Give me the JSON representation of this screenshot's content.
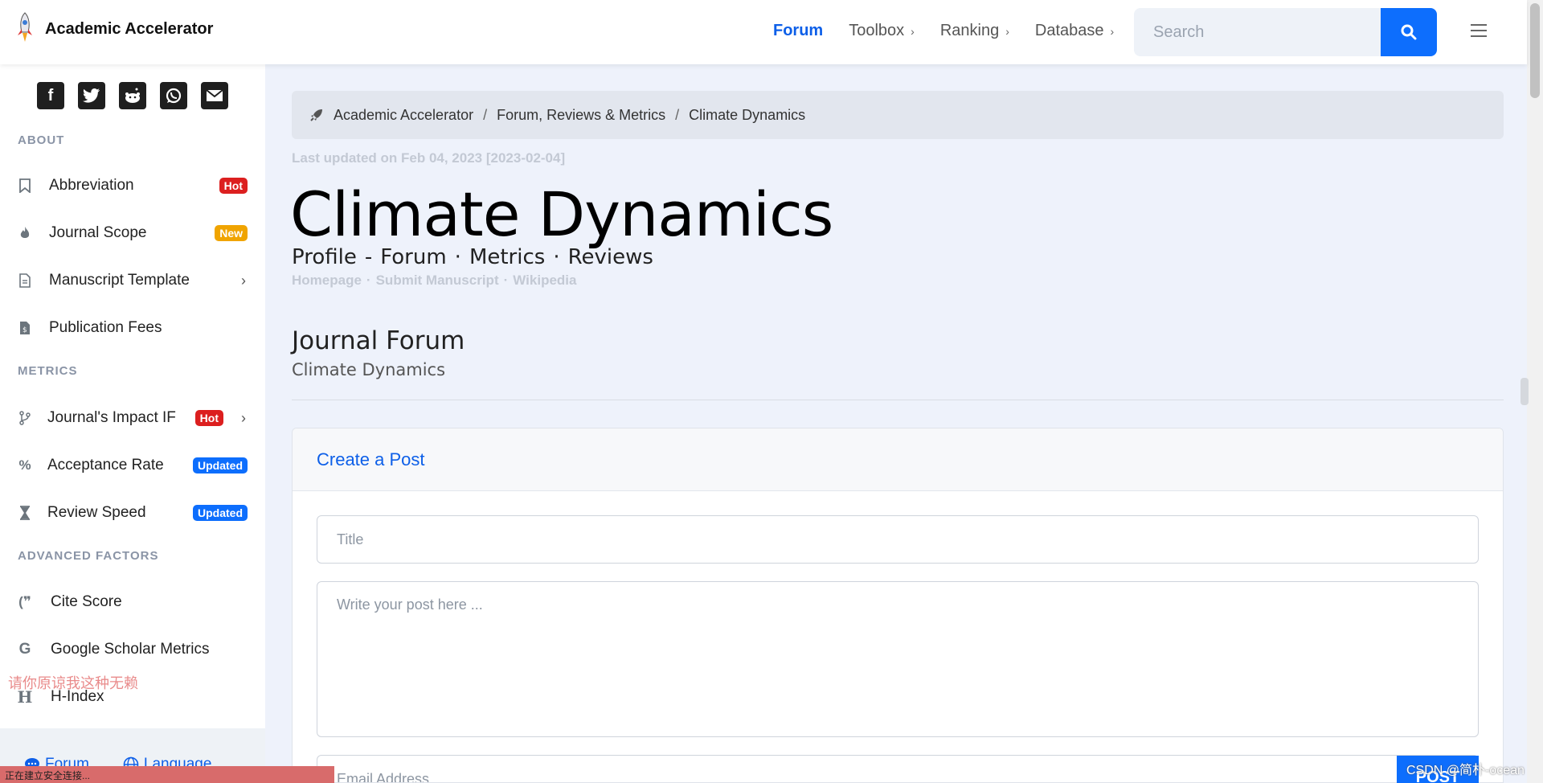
{
  "brand": {
    "name": "Academic Accelerator"
  },
  "nav": {
    "items": [
      {
        "label": "Forum",
        "active": true,
        "has_chevron": false
      },
      {
        "label": "Toolbox",
        "active": false,
        "has_chevron": true
      },
      {
        "label": "Ranking",
        "active": false,
        "has_chevron": true
      },
      {
        "label": "Database",
        "active": false,
        "has_chevron": true
      }
    ],
    "search_placeholder": "Search"
  },
  "sidebar": {
    "social": [
      "facebook-icon",
      "twitter-icon",
      "reddit-icon",
      "whatsapp-icon",
      "email-icon"
    ],
    "sections": {
      "about": "ABOUT",
      "metrics": "METRICS",
      "advanced": "ADVANCED FACTORS"
    },
    "items": [
      {
        "label": "Abbreviation",
        "icon": "bookmark-icon",
        "badge": "Hot"
      },
      {
        "label": "Journal Scope",
        "icon": "fire-icon",
        "badge": "New"
      },
      {
        "label": "Manuscript Template",
        "icon": "document-icon",
        "badge": ""
      },
      {
        "label": "Publication Fees",
        "icon": "invoice-icon",
        "badge": ""
      },
      {
        "label": "Journal's Impact IF",
        "icon": "branch-icon",
        "badge": "Hot"
      },
      {
        "label": "Acceptance Rate",
        "icon": "percent-icon",
        "badge": "Updated"
      },
      {
        "label": "Review Speed",
        "icon": "hourglass-icon",
        "badge": "Updated"
      },
      {
        "label": "Cite Score",
        "icon": "quote-icon",
        "badge": ""
      },
      {
        "label": "Google Scholar Metrics",
        "icon": "google-icon",
        "badge": ""
      },
      {
        "label": "H-Index",
        "icon": "h-icon",
        "badge": ""
      }
    ],
    "footer": {
      "forum": "Forum",
      "language": "Language"
    }
  },
  "breadcrumb": [
    "Academic Accelerator",
    "Forum, Reviews & Metrics",
    "Climate Dynamics"
  ],
  "main": {
    "updated": "Last updated on Feb 04, 2023 [2023-02-04]",
    "title": "Climate Dynamics",
    "subtitle_links": [
      "Profile",
      "Forum",
      "Metrics",
      "Reviews"
    ],
    "sublinks": [
      "Homepage",
      "Submit Manuscript",
      "Wikipedia"
    ],
    "forum_heading": "Journal Forum",
    "forum_sub": "Climate Dynamics"
  },
  "post_card": {
    "header": "Create a Post",
    "title_placeholder": "Title",
    "body_placeholder": "Write your post here ...",
    "email_placeholder": "Email Address",
    "button": "POST"
  },
  "overlays": {
    "status": "正在建立安全连接...",
    "red_text": "请你原谅我这种无赖",
    "watermark": "CSDN @简朴-ocean"
  },
  "colors": {
    "accent": "#0d6efd",
    "hot": "#dc1f1f",
    "new": "#f0a400"
  }
}
